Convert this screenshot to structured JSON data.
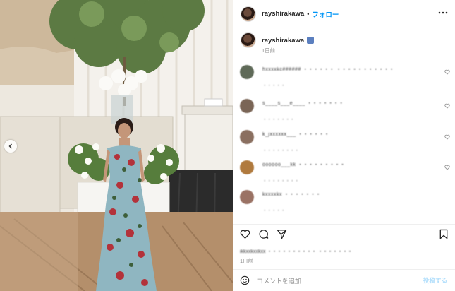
{
  "header": {
    "username": "rayshirakawa",
    "separator": "•",
    "follow_label": "フォロー",
    "more_icon": "more-horizontal-icon"
  },
  "caption": {
    "username": "rayshirakawa",
    "time": "1日前"
  },
  "comments": [
    {
      "text": "hxxxxkc######  ・・・・・・ ・・・・・・・・・・・",
      "meta": "・・・・・",
      "avatar_color": "#5f6a58"
    },
    {
      "text": "s____s___e____ ・・・・・・・",
      "meta": "・・・・・・・",
      "avatar_color": "#7a6556"
    },
    {
      "text": "k_jxxxxxx___ ・・・・・・",
      "meta": "・・・・・・・・",
      "avatar_color": "#8a6f60"
    },
    {
      "text": "oooooo___kk ・・・・・・・・・",
      "meta": "・・・・・・・・",
      "avatar_color": "#b07a3e"
    },
    {
      "text": "kxxxxkx ・・・・・・・",
      "meta": "・・・・・",
      "avatar_color": "#9a7264"
    }
  ],
  "likes_text": "ikkxxkxxkxx ・・・・・・・・・・ ・・・・・・・",
  "post_time": "1日前",
  "add_comment": {
    "placeholder": "コメントを追加...",
    "post_label": "投稿する"
  },
  "colors": {
    "accent": "#0095f6",
    "post_disabled": "#b2dffc"
  }
}
